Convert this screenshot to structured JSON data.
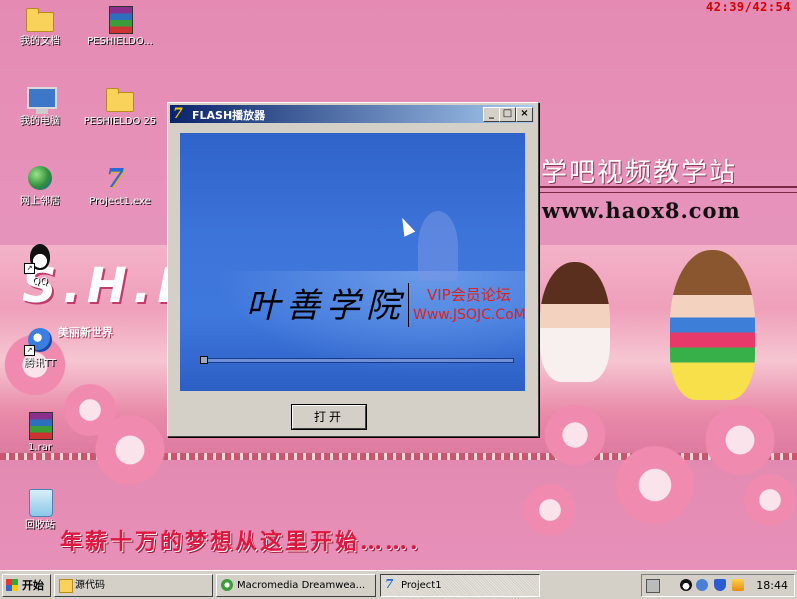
{
  "clock": "42:39/42:54",
  "banner": {
    "title": "学吧视频教学站",
    "url": "www.haox8.com"
  },
  "wallpaper": {
    "logo": "S.H.E",
    "subtitle": "美丽新世界",
    "slogan": "年薪十万的梦想从这里开始……."
  },
  "desktop_icons": [
    {
      "label": "我的文档",
      "icon": "my-documents-folder-icon"
    },
    {
      "label": "PESHIELDO...",
      "icon": "rar-archive-icon"
    },
    {
      "label": "我的电脑",
      "icon": "my-computer-icon"
    },
    {
      "label": "PESHIELDO 25",
      "icon": "folder-icon"
    },
    {
      "label": "网上邻居",
      "icon": "network-places-icon"
    },
    {
      "label": "Project1.exe",
      "icon": "flash-player-exe-icon"
    },
    {
      "label": "QQ",
      "icon": "qq-penguin-icon"
    },
    {
      "label": "腾讯TT",
      "icon": "tencent-tt-icon"
    },
    {
      "label": "1.rar",
      "icon": "rar-archive-icon"
    },
    {
      "label": "回收站",
      "icon": "recycle-bin-icon"
    }
  ],
  "window": {
    "title": "FLASH播放器",
    "buttons": {
      "minimize": "_",
      "maximize": "□",
      "close": "×"
    },
    "stage": {
      "logo": "叶善学院",
      "vip": "VIP会员论坛",
      "site": "Www.JSOJC.CoM"
    },
    "progress": 0.0,
    "open_button": "打开"
  },
  "taskbar": {
    "start": "开始",
    "items": [
      {
        "label": "源代码",
        "icon": "folder-icon",
        "active": false
      },
      {
        "label": "Macromedia Dreamwea...",
        "icon": "dreamweaver-icon",
        "active": false
      },
      {
        "label": "Project1",
        "icon": "flash-player-exe-icon",
        "active": true
      }
    ],
    "time": "18:44"
  }
}
